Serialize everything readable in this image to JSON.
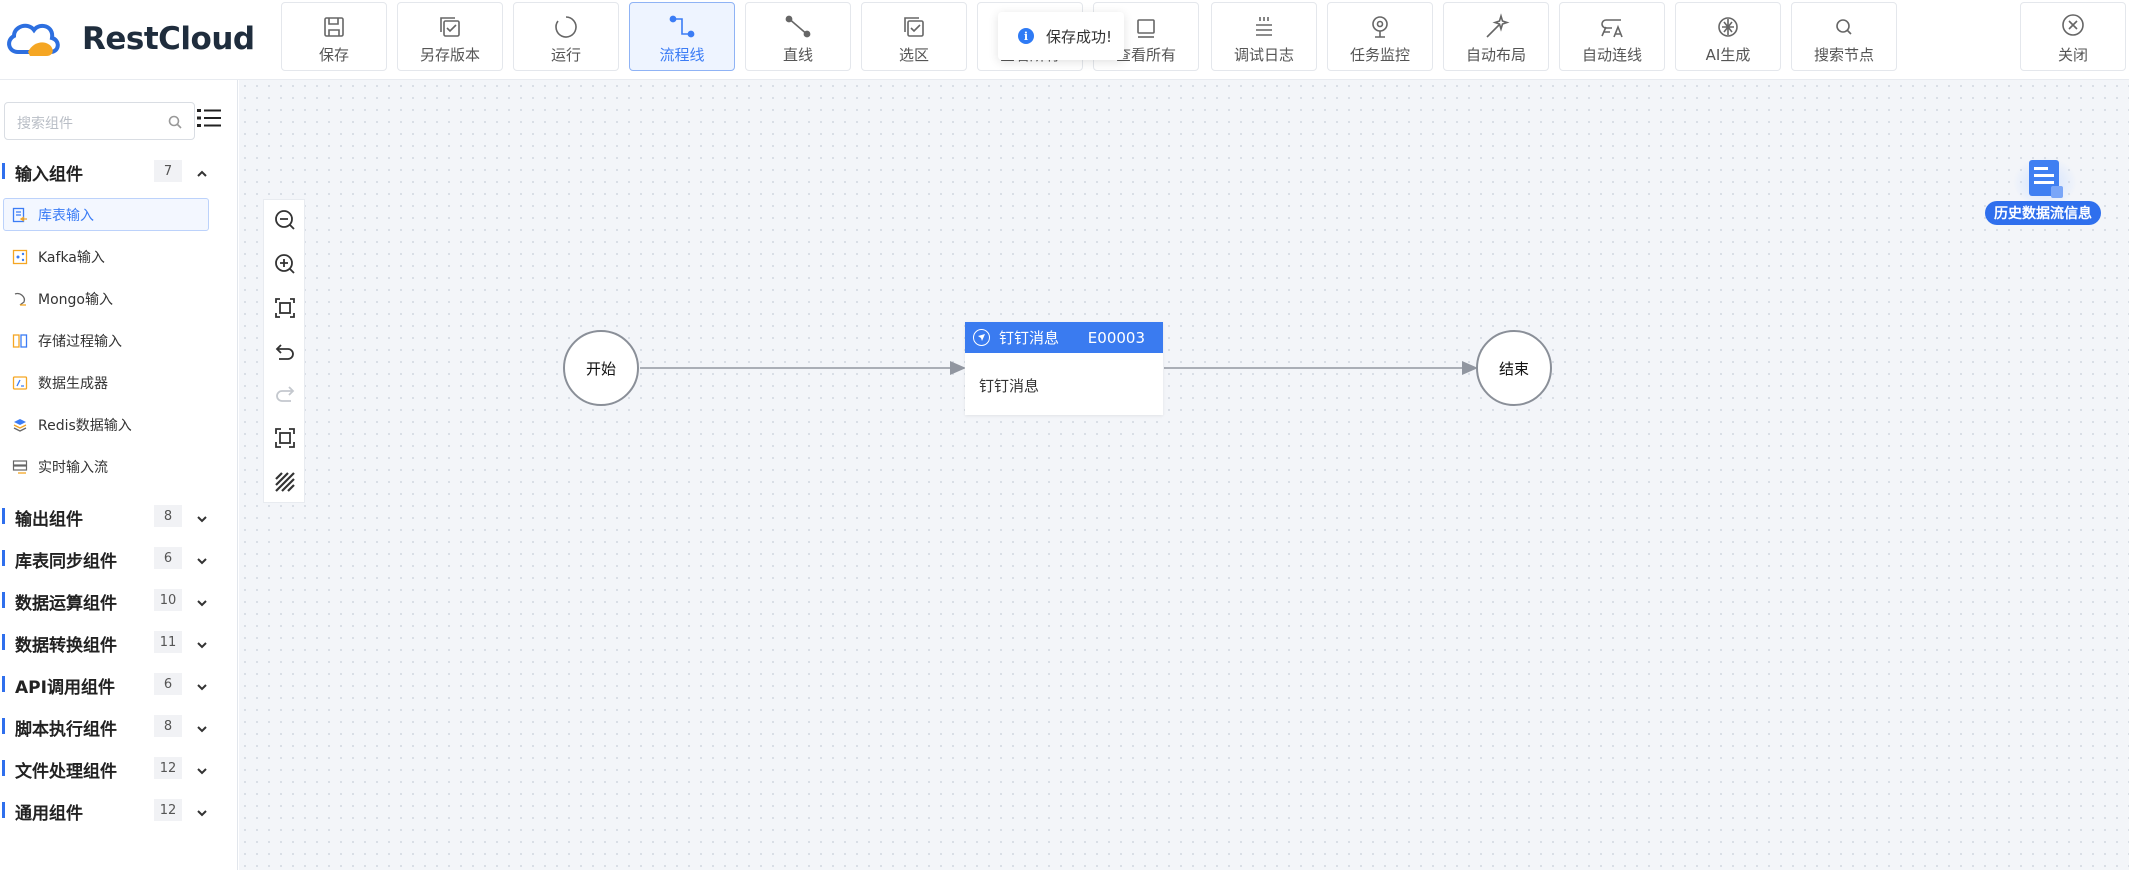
{
  "app": {
    "brand": "RestCloud"
  },
  "toolbar": {
    "items": [
      {
        "label": "保存",
        "icon": "save-icon"
      },
      {
        "label": "另存版本",
        "icon": "save-version-icon"
      },
      {
        "label": "运行",
        "icon": "run-icon"
      },
      {
        "label": "流程线",
        "icon": "flow-line-icon",
        "active": true
      },
      {
        "label": "直线",
        "icon": "straight-line-icon"
      },
      {
        "label": "选区",
        "icon": "select-area-icon"
      },
      {
        "label": "查看所有",
        "icon": "view-all-icon"
      },
      {
        "label": "调试日志",
        "icon": "debug-log-icon"
      },
      {
        "label": "任务监控",
        "icon": "task-monitor-icon"
      },
      {
        "label": "自动布局",
        "icon": "auto-layout-icon"
      },
      {
        "label": "自动连线",
        "icon": "auto-connect-icon"
      },
      {
        "label": "AI生成",
        "icon": "ai-generate-icon"
      },
      {
        "label": "搜索节点",
        "icon": "search-node-icon"
      }
    ],
    "close_label": "关闭"
  },
  "toast": {
    "message": "保存成功!"
  },
  "sidebar": {
    "search_placeholder": "搜索组件",
    "groups": [
      {
        "name": "输入组件",
        "count": "7",
        "expanded": true
      },
      {
        "name": "输出组件",
        "count": "8"
      },
      {
        "name": "库表同步组件",
        "count": "6"
      },
      {
        "name": "数据运算组件",
        "count": "10"
      },
      {
        "name": "数据转换组件",
        "count": "11"
      },
      {
        "name": "API调用组件",
        "count": "6"
      },
      {
        "name": "脚本执行组件",
        "count": "8"
      },
      {
        "name": "文件处理组件",
        "count": "12"
      },
      {
        "name": "通用组件",
        "count": "12"
      }
    ],
    "input_items": [
      {
        "label": "库表输入",
        "selected": true
      },
      {
        "label": "Kafka输入"
      },
      {
        "label": "Mongo输入"
      },
      {
        "label": "存储过程输入"
      },
      {
        "label": "数据生成器"
      },
      {
        "label": "Redis数据输入"
      },
      {
        "label": "实时输入流"
      }
    ]
  },
  "canvas": {
    "start_label": "开始",
    "end_label": "结束",
    "task": {
      "title": "钉钉消息",
      "code": "E00003",
      "body": "钉钉消息"
    },
    "history_label": "历史数据流信息"
  },
  "colors": {
    "accent": "#3a7bf0",
    "canvas_bg": "#f3f5f9"
  }
}
